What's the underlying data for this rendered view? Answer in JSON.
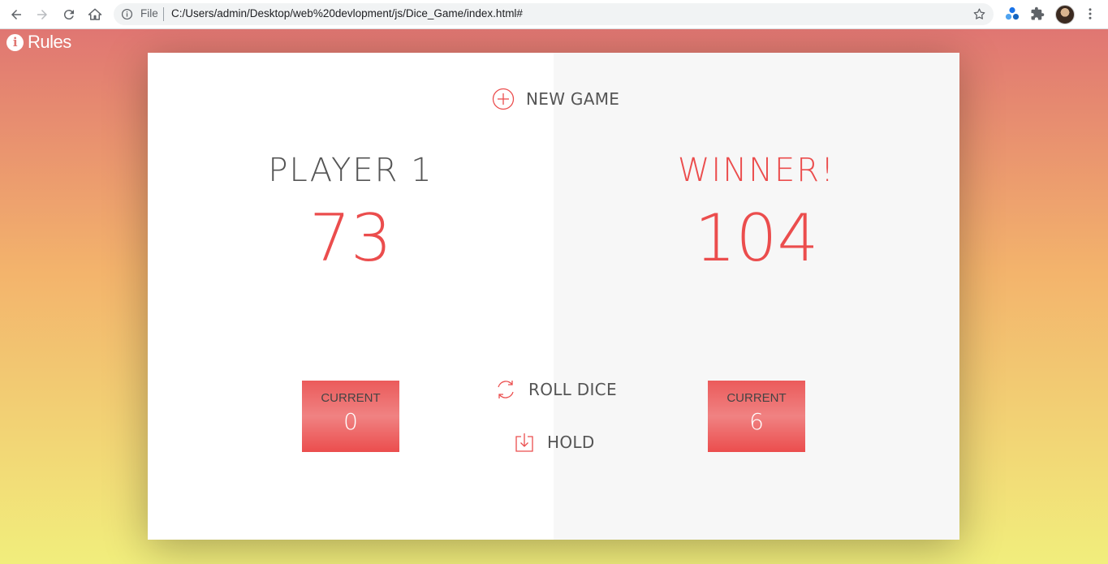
{
  "browser": {
    "file_label": "File",
    "url": "C:/Users/admin/Desktop/web%20devlopment/js/Dice_Game/index.html#"
  },
  "page": {
    "rules_label": "Rules"
  },
  "game": {
    "new_game_label": "NEW GAME",
    "roll_dice_label": "ROLL DICE",
    "hold_label": "HOLD",
    "player1": {
      "name": "PLAYER 1",
      "score": "73",
      "current_label": "CURRENT",
      "current_score": "0"
    },
    "player2": {
      "name": "WINNER!",
      "score": "104",
      "current_label": "CURRENT",
      "current_score": "6"
    }
  },
  "colors": {
    "accent": "#eb4d4d",
    "gradient_top": "#e07672",
    "gradient_bottom": "#f1ee7c"
  }
}
